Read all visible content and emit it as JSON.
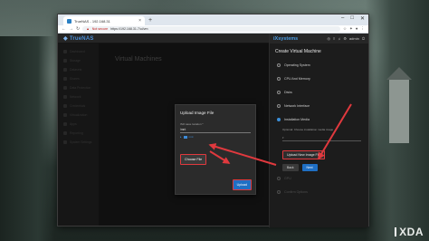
{
  "browser": {
    "tab_title": "TrueNAS - 192.168.31",
    "url": "https://192.168.31.7/ui/vm",
    "not_secure": "Not secure"
  },
  "app": {
    "brand": "TrueNAS",
    "page_title": "Virtual Machines",
    "sidebar_items": [
      "Dashboard",
      "Storage",
      "Datasets",
      "Shares",
      "Data Protection",
      "Network",
      "Credentials",
      "Virtualization",
      "Apps",
      "Reporting",
      "System Settings"
    ]
  },
  "wizard": {
    "brand": "iXsystems",
    "user": "admin",
    "title": "Create Virtual Machine",
    "steps": [
      {
        "label": "Operating System",
        "state": "done"
      },
      {
        "label": "CPU And Memory",
        "state": "done"
      },
      {
        "label": "Disks",
        "state": "done"
      },
      {
        "label": "Network Interface",
        "state": "done"
      },
      {
        "label": "Installation Media",
        "state": "active"
      },
      {
        "label": "GPU",
        "state": "pending"
      },
      {
        "label": "Confirm Options",
        "state": "pending"
      }
    ],
    "installation_media": {
      "field_label": "Optional: Choose installation media image",
      "upload_new_label": "Upload New Image File"
    },
    "back_label": "Back",
    "next_label": "Next"
  },
  "modal": {
    "title": "Upload Image File",
    "iso_label": "ISO save location *",
    "iso_path": "/mnt",
    "tree_item": "mnt",
    "choose_file_label": "Choose File",
    "upload_label": "Upload"
  },
  "watermark": "XDA",
  "colors": {
    "highlight": "#e0393e",
    "primary": "#1f6fc4",
    "brand": "#4a8fd8"
  }
}
